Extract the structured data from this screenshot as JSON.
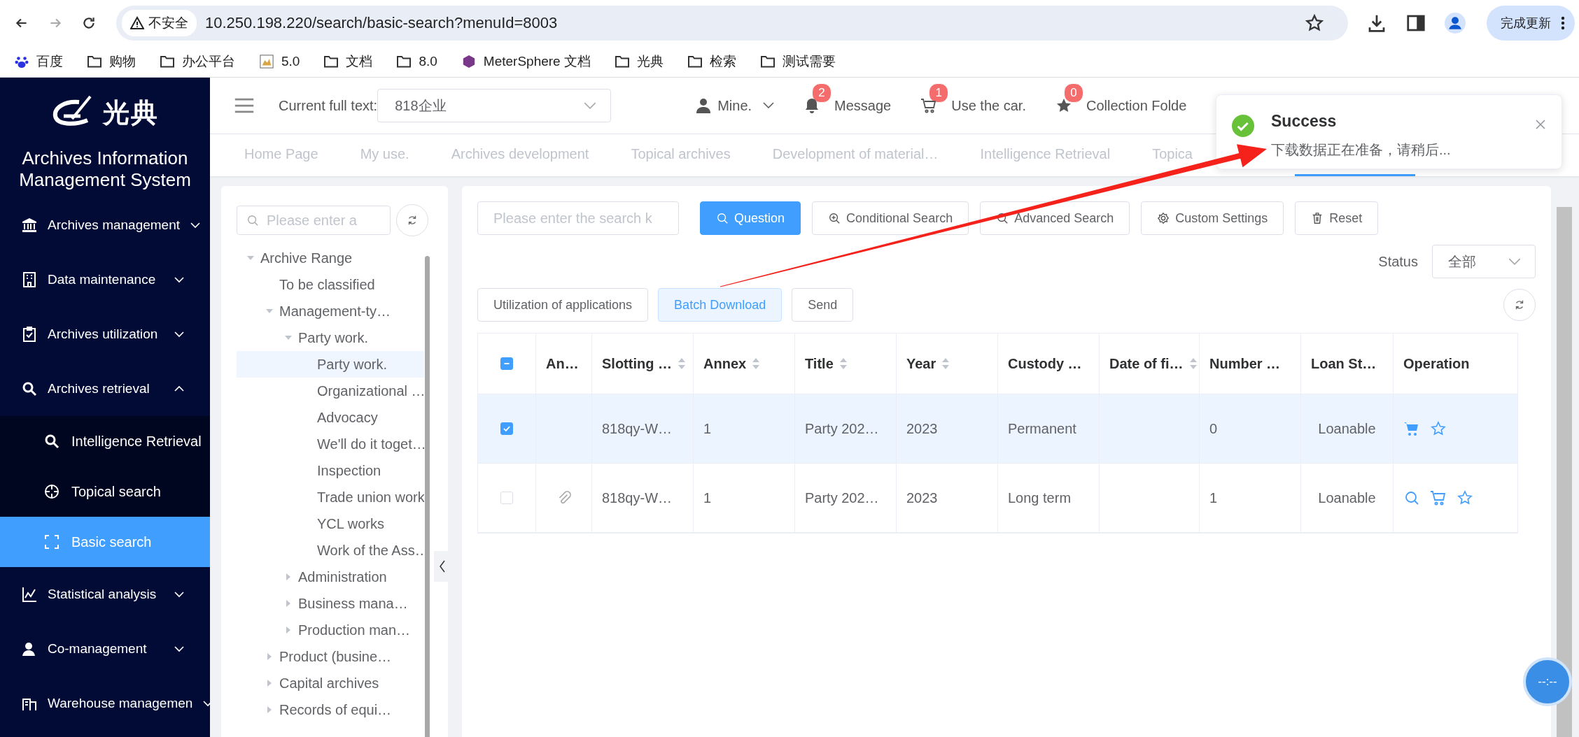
{
  "browser": {
    "security_label": "不安全",
    "url": "10.250.198.220/search/basic-search?menuId=8003",
    "update_button": "完成更新"
  },
  "bookmarks": [
    {
      "kind": "baidu",
      "label": "百度"
    },
    {
      "kind": "folder",
      "label": "购物"
    },
    {
      "kind": "folder",
      "label": "办公平台"
    },
    {
      "kind": "image",
      "label": "5.0"
    },
    {
      "kind": "folder",
      "label": "文档"
    },
    {
      "kind": "folder",
      "label": "8.0"
    },
    {
      "kind": "cube",
      "label": "MeterSphere 文档"
    },
    {
      "kind": "folder",
      "label": "光典"
    },
    {
      "kind": "folder",
      "label": "检索"
    },
    {
      "kind": "folder",
      "label": "测试需要"
    }
  ],
  "sidebar": {
    "logo_text": "光典",
    "title": "Archives Information Management System",
    "items": [
      {
        "kind": "bank",
        "label": "Archives management",
        "expanded": false,
        "selected": false
      },
      {
        "kind": "building",
        "label": "Data maintenance",
        "expanded": false,
        "selected": false
      },
      {
        "kind": "clipboard",
        "label": "Archives utilization",
        "expanded": false,
        "selected": false
      },
      {
        "kind": "search",
        "label": "Archives retrieval",
        "expanded": true,
        "selected": false,
        "children": [
          {
            "kind": "search",
            "label": "Intelligence Retrieval",
            "selected": false
          },
          {
            "kind": "crosshair",
            "label": "Topical search",
            "selected": false
          },
          {
            "kind": "scan",
            "label": "Basic search",
            "selected": true
          }
        ]
      },
      {
        "kind": "chart",
        "label": "Statistical analysis",
        "expanded": false,
        "selected": false
      },
      {
        "kind": "people",
        "label": "Co-management",
        "expanded": false,
        "selected": false
      },
      {
        "kind": "warehouse",
        "label": "Warehouse managemen",
        "expanded": false,
        "selected": false
      }
    ]
  },
  "header": {
    "full_text_label": "Current full text:",
    "full_text_value": "818企业",
    "user": "Mine.",
    "notices": [
      {
        "kind": "bell",
        "label": "Message",
        "badge": "2"
      },
      {
        "kind": "cart",
        "label": "Use the car.",
        "badge": "1"
      },
      {
        "kind": "star",
        "label": "Collection Folde",
        "badge": "0"
      }
    ]
  },
  "tabs": [
    {
      "label": "Home Page",
      "selected": false
    },
    {
      "label": "My use.",
      "selected": false
    },
    {
      "label": "Archives development",
      "selected": false
    },
    {
      "label": "Topical archives",
      "selected": false
    },
    {
      "label": "Development of material…",
      "selected": false
    },
    {
      "label": "Intelligence Retrieval",
      "selected": false
    },
    {
      "label": "Topica",
      "selected": false
    },
    {
      "selected": true
    }
  ],
  "tree": {
    "placeholder": "Please enter a",
    "nodes": [
      {
        "label": "Archive Range",
        "expanded": true,
        "selected": false,
        "children": [
          {
            "label": "To be classified",
            "selected": false
          },
          {
            "label": "Management-ty…",
            "expanded": true,
            "selected": false,
            "children": [
              {
                "label": "Party work.",
                "expanded": true,
                "selected": false,
                "children": [
                  {
                    "label": "Party work.",
                    "selected": true
                  },
                  {
                    "label": "Organizational …",
                    "selected": false
                  },
                  {
                    "label": "Advocacy",
                    "selected": false
                  },
                  {
                    "label": "We'll do it toget…",
                    "selected": false
                  },
                  {
                    "label": "Inspection",
                    "selected": false
                  },
                  {
                    "label": "Trade union work",
                    "selected": false
                  },
                  {
                    "label": "YCL works",
                    "selected": false
                  },
                  {
                    "label": "Work of the Ass…",
                    "selected": false
                  }
                ]
              },
              {
                "label": "Administration",
                "expanded": false,
                "selected": false
              },
              {
                "label": "Business mana…",
                "expanded": false,
                "selected": false
              },
              {
                "label": "Production man…",
                "expanded": false,
                "selected": false
              }
            ]
          },
          {
            "label": "Product (busine…",
            "expanded": false,
            "selected": false
          },
          {
            "label": "Capital archives",
            "expanded": false,
            "selected": false
          },
          {
            "label": "Records of equi…",
            "expanded": false,
            "selected": false
          }
        ]
      }
    ]
  },
  "toolbar": {
    "search_placeholder": "Please enter the search k",
    "buttons": [
      {
        "kind": "question",
        "label": "Question",
        "primary": true
      },
      {
        "kind": "conditional",
        "label": "Conditional Search",
        "primary": false
      },
      {
        "kind": "advanced",
        "label": "Advanced Search",
        "primary": false
      },
      {
        "kind": "settings",
        "label": "Custom Settings",
        "primary": false
      },
      {
        "kind": "reset",
        "label": "Reset",
        "primary": false
      }
    ]
  },
  "status": {
    "label": "Status",
    "value": "全部"
  },
  "actions": [
    {
      "label": "Utilization of applications",
      "focused": false
    },
    {
      "label": "Batch Download",
      "focused": true
    },
    {
      "label": "Send",
      "focused": false
    }
  ],
  "table": {
    "select_all_indeterminate": true,
    "columns": [
      {
        "label": "An…",
        "sortable": false
      },
      {
        "label": "Slotting …",
        "sortable": true
      },
      {
        "label": "Annex",
        "sortable": true
      },
      {
        "label": "Title",
        "sortable": true
      },
      {
        "label": "Year",
        "sortable": true
      },
      {
        "label": "Custody …",
        "sortable": false
      },
      {
        "label": "Date of fi…",
        "sortable": true
      },
      {
        "label": "Number …",
        "sortable": false
      },
      {
        "label": "Loan St…",
        "sortable": false
      },
      {
        "label": "Operation",
        "sortable": false
      }
    ],
    "rows": [
      {
        "checked": true,
        "attachment": false,
        "slotting": "818qy-W…",
        "annex": "1",
        "title": "Party 202…",
        "year": "2023",
        "custody": "Permanent",
        "number": "0",
        "loan_status": "Loanable",
        "actions": [
          {
            "kind": "cart-filled"
          },
          {
            "kind": "star"
          }
        ]
      },
      {
        "checked": false,
        "attachment": true,
        "slotting": "818qy-W…",
        "annex": "1",
        "title": "Party 202…",
        "year": "2023",
        "custody": "Long term",
        "number": "1",
        "loan_status": "Loanable",
        "actions": [
          {
            "kind": "search"
          },
          {
            "kind": "cart"
          },
          {
            "kind": "star"
          }
        ]
      }
    ]
  },
  "toast": {
    "title": "Success",
    "message": "下载数据正在准备，请稍后..."
  },
  "timer": {
    "label": "--:--"
  }
}
